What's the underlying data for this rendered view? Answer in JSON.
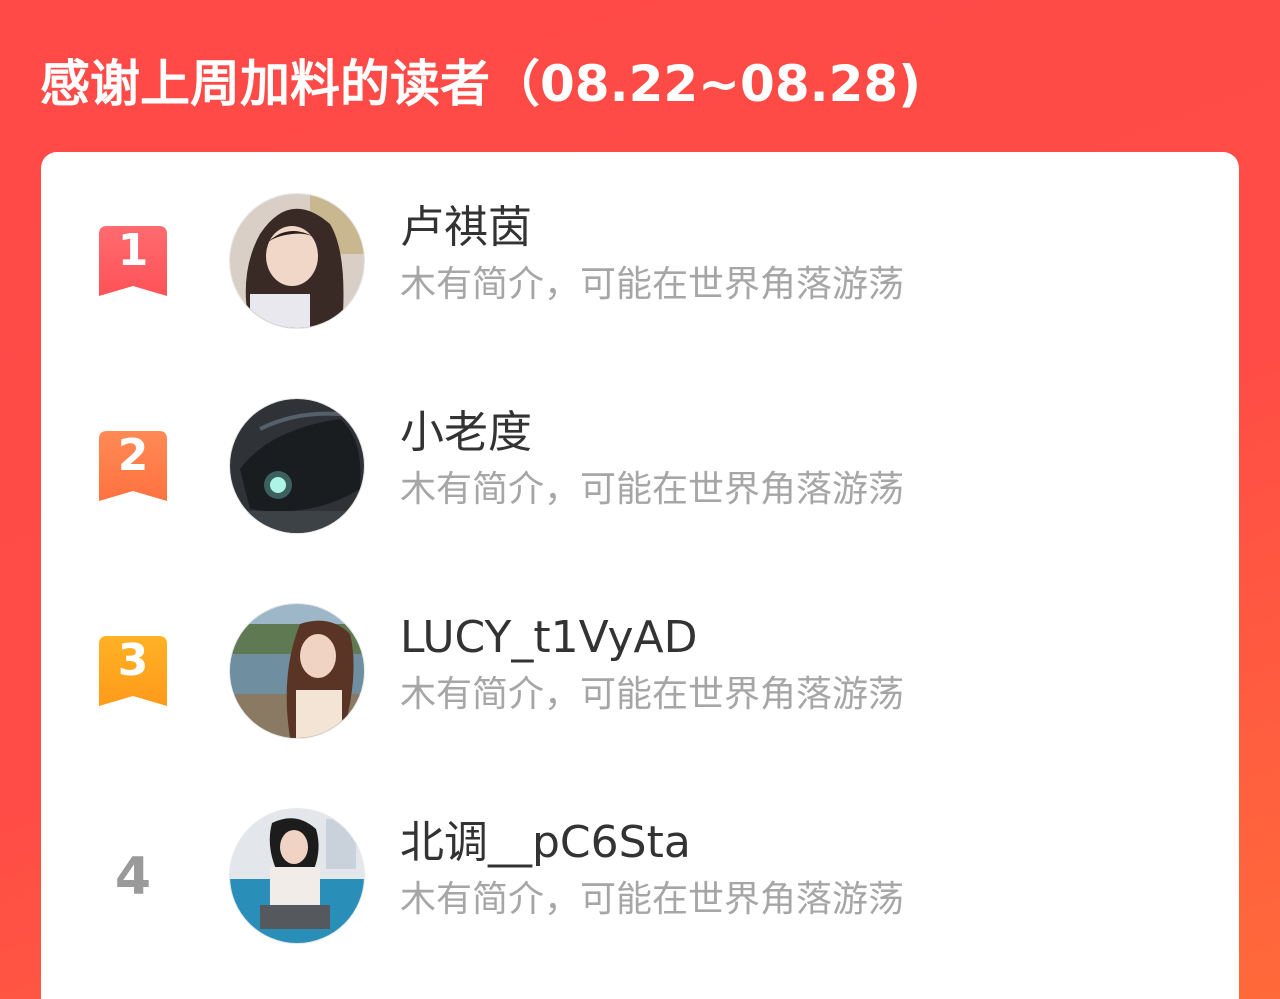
{
  "header": {
    "title": "感谢上周加料的读者（08.22~08.28)"
  },
  "colors": {
    "background": "#ff4a47",
    "rank_1": "#ff5a5f",
    "rank_2": "#ff7a4a",
    "rank_3": "#ffa21f",
    "rank_plain": "#9a9a9a",
    "bio_text": "#a6a6a6"
  },
  "readers": [
    {
      "rank": "1",
      "name": "卢祺茵",
      "bio": "木有简介，可能在世界角落游荡",
      "avatar_icon": "avatar-photo-girl-icon"
    },
    {
      "rank": "2",
      "name": "小老度",
      "bio": "木有简介，可能在世界角落游荡",
      "avatar_icon": "avatar-photo-dark-car-icon"
    },
    {
      "rank": "3",
      "name": "LUCY_t1VyAD",
      "bio": "木有简介，可能在世界角落游荡",
      "avatar_icon": "avatar-photo-lakeside-icon"
    },
    {
      "rank": "4",
      "name": "北调__pC6Sta",
      "bio": "木有简介，可能在世界角落游荡",
      "avatar_icon": "avatar-photo-room-icon"
    }
  ]
}
